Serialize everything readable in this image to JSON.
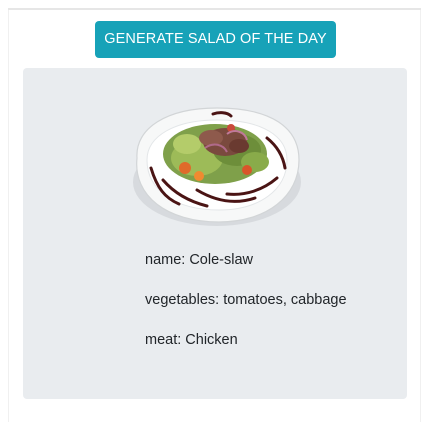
{
  "button": {
    "label": "GENERATE SALAD OF THE DAY"
  },
  "salad": {
    "image_icon": "salad-plate-image",
    "name": "name: Cole-slaw",
    "vegetables": "vegetables: tomatoes, cabbage",
    "meat": "meat: Chicken"
  },
  "colors": {
    "button_bg": "#17a2b8",
    "card_bg": "#e9ecef",
    "text": "#212529"
  }
}
